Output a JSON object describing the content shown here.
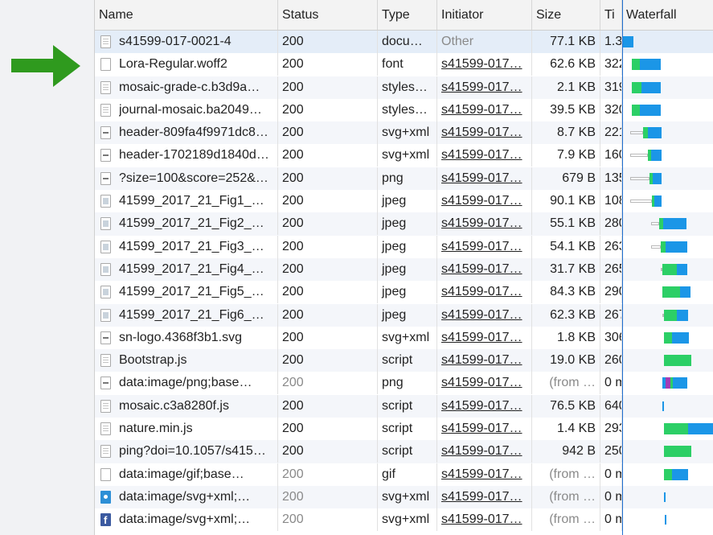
{
  "columns": {
    "name": "Name",
    "status": "Status",
    "type": "Type",
    "initiator": "Initiator",
    "size": "Size",
    "time": "Ti",
    "waterfall": "Waterfall"
  },
  "colors": {
    "arrow": "#2f9a1e",
    "waiting": "#2ccf66",
    "download": "#1b96e7"
  },
  "rows": [
    {
      "name": "s41599-017-0021-4",
      "status": "200",
      "type": "docu…",
      "initiator": "Other",
      "size": "77.1 KB",
      "time": "1.3",
      "icon": "doc-icon"
    },
    {
      "name": "Lora-Regular.woff2",
      "status": "200",
      "type": "font",
      "initiator": "s41599-017…",
      "size": "62.6 KB",
      "time": "322",
      "icon": "file-icon"
    },
    {
      "name": "mosaic-grade-c.b3d9a…",
      "status": "200",
      "type": "styles…",
      "initiator": "s41599-017…",
      "size": "2.1 KB",
      "time": "319",
      "icon": "doc-icon"
    },
    {
      "name": "journal-mosaic.ba2049…",
      "status": "200",
      "type": "styles…",
      "initiator": "s41599-017…",
      "size": "39.5 KB",
      "time": "320",
      "icon": "doc-icon"
    },
    {
      "name": "header-809fa4f9971dc8…",
      "status": "200",
      "type": "svg+xml",
      "initiator": "s41599-017…",
      "size": "8.7 KB",
      "time": "221",
      "icon": "svg-icon"
    },
    {
      "name": "header-1702189d1840d…",
      "status": "200",
      "type": "svg+xml",
      "initiator": "s41599-017…",
      "size": "7.9 KB",
      "time": "160",
      "icon": "svg-icon"
    },
    {
      "name": "?size=100&score=252&…",
      "status": "200",
      "type": "png",
      "initiator": "s41599-017…",
      "size": "679 B",
      "time": "135",
      "icon": "image-line-icon"
    },
    {
      "name": "41599_2017_21_Fig1_…",
      "status": "200",
      "type": "jpeg",
      "initiator": "s41599-017…",
      "size": "90.1 KB",
      "time": "108",
      "icon": "image-icon"
    },
    {
      "name": "41599_2017_21_Fig2_…",
      "status": "200",
      "type": "jpeg",
      "initiator": "s41599-017…",
      "size": "55.1 KB",
      "time": "280",
      "icon": "image-icon"
    },
    {
      "name": "41599_2017_21_Fig3_…",
      "status": "200",
      "type": "jpeg",
      "initiator": "s41599-017…",
      "size": "54.1 KB",
      "time": "263",
      "icon": "image-icon"
    },
    {
      "name": "41599_2017_21_Fig4_…",
      "status": "200",
      "type": "jpeg",
      "initiator": "s41599-017…",
      "size": "31.7 KB",
      "time": "265",
      "icon": "image-icon"
    },
    {
      "name": "41599_2017_21_Fig5_…",
      "status": "200",
      "type": "jpeg",
      "initiator": "s41599-017…",
      "size": "84.3 KB",
      "time": "290",
      "icon": "image-icon"
    },
    {
      "name": "41599_2017_21_Fig6_…",
      "status": "200",
      "type": "jpeg",
      "initiator": "s41599-017…",
      "size": "62.3 KB",
      "time": "267",
      "icon": "image-icon"
    },
    {
      "name": "sn-logo.4368f3b1.svg",
      "status": "200",
      "type": "svg+xml",
      "initiator": "s41599-017…",
      "size": "1.8 KB",
      "time": "306",
      "icon": "svg-icon"
    },
    {
      "name": "Bootstrap.js",
      "status": "200",
      "type": "script",
      "initiator": "s41599-017…",
      "size": "19.0 KB",
      "time": "260",
      "icon": "doc-icon"
    },
    {
      "name": "data:image/png;base…",
      "status": "200",
      "type": "png",
      "initiator": "s41599-017…",
      "size": "(from …",
      "time": "0 m",
      "icon": "image-line-icon"
    },
    {
      "name": "mosaic.c3a8280f.js",
      "status": "200",
      "type": "script",
      "initiator": "s41599-017…",
      "size": "76.5 KB",
      "time": "640",
      "icon": "doc-icon"
    },
    {
      "name": "nature.min.js",
      "status": "200",
      "type": "script",
      "initiator": "s41599-017…",
      "size": "1.4 KB",
      "time": "293",
      "icon": "doc-icon"
    },
    {
      "name": "ping?doi=10.1057/s415…",
      "status": "200",
      "type": "script",
      "initiator": "s41599-017…",
      "size": "942 B",
      "time": "250",
      "icon": "doc-icon"
    },
    {
      "name": "data:image/gif;base…",
      "status": "200",
      "type": "gif",
      "initiator": "s41599-017…",
      "size": "(from …",
      "time": "0 m",
      "icon": "file-icon"
    },
    {
      "name": "data:image/svg+xml;…",
      "status": "200",
      "type": "svg+xml",
      "initiator": "s41599-017…",
      "size": "(from …",
      "time": "0 m",
      "icon": "twitter-icon"
    },
    {
      "name": "data:image/svg+xml;…",
      "status": "200",
      "type": "svg+xml",
      "initiator": "s41599-017…",
      "size": "(from …",
      "time": "0 m",
      "icon": "facebook-icon"
    }
  ]
}
